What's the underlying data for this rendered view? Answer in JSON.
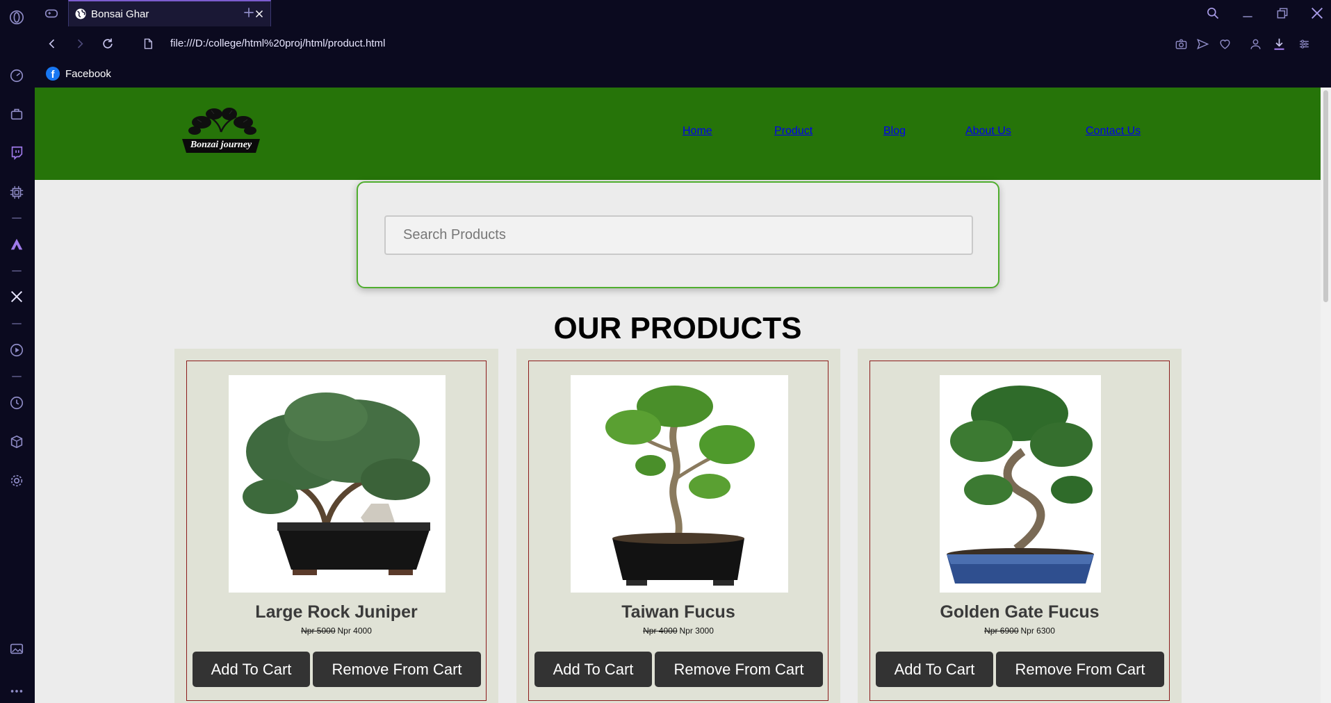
{
  "browser": {
    "tab_title": "Bonsai Ghar",
    "url": "file:///D:/college/html%20proj/html/product.html",
    "bookmarks": [
      {
        "label": "Facebook",
        "icon": "facebook-icon"
      }
    ],
    "accent_color": "#7c5ccf"
  },
  "site": {
    "header_color": "#267409",
    "logo_text": "Bonzai journey",
    "nav": {
      "home": "Home",
      "product": "Product",
      "blog": "Blog",
      "about": "About Us",
      "contact": "Contact Us"
    },
    "search": {
      "placeholder": "Search Products"
    },
    "section_title": "OUR PRODUCTS",
    "products": [
      {
        "name": "Large Rock Juniper",
        "old_price": "Npr 5000",
        "price": "Npr 4000",
        "add_label": "Add To Cart",
        "remove_label": "Remove From Cart",
        "image": "juniper-bonsai"
      },
      {
        "name": "Taiwan Fucus",
        "old_price": "Npr 4000",
        "price": "Npr 3000",
        "add_label": "Add To Cart",
        "remove_label": "Remove From Cart",
        "image": "ficus-bonsai"
      },
      {
        "name": "Golden Gate Fucus",
        "old_price": "Npr 6900",
        "price": "Npr 6300",
        "add_label": "Add To Cart",
        "remove_label": "Remove From Cart",
        "image": "ficus-blue-pot-bonsai"
      }
    ]
  }
}
